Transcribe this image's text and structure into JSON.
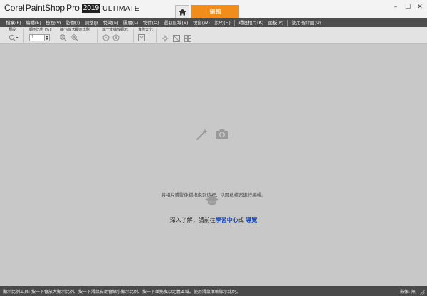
{
  "app": {
    "logo_corel": "Corel",
    "logo_paintshop": "PaintShop",
    "logo_pro": "Pro",
    "logo_year": "2019",
    "logo_edition": "ULTIMATE"
  },
  "tabs": {
    "edit": "編輯"
  },
  "window_controls": {
    "minimize": "–",
    "maximize": "☐",
    "close": "✕"
  },
  "menu": [
    "檔案(F)",
    "編輯(E)",
    "檢視(V)",
    "影像(I)",
    "調整(J)",
    "特效(E)",
    "圖層(L)",
    "物件(O)",
    "選取區域(S)",
    "視窗(W)",
    "說明(H)",
    "環繞相片(R)",
    "面板(P)",
    "使用者介面(U)"
  ],
  "toolbar": {
    "preset_label": "預設:",
    "zoom_percent_label": "顯示比例 (%):",
    "zoom_value": "1",
    "zoom_inout_label": "縮小/放大顯示比例:",
    "step_label": "進一步縮放顯示:",
    "actual_size_label": "實際大小:"
  },
  "workspace": {
    "drop_hint": "將相片或影像檔拖曳到這裡，以開啟檔案進行編輯。",
    "learn_prefix": "深入了解，請前往",
    "learning_center": "學習中心",
    "learn_or": "或",
    "guide": "導覽"
  },
  "status": {
    "text": "顯示比例工具: 按一下會放大顯示比例。按一下滑鼠右鍵會縮小顯示比例。按一下並拖曳以定義區域。使用滑鼠滾輪顯示比例。",
    "image": "影像: 無"
  },
  "colors": {
    "accent_orange": "#f28c1b",
    "menubar_bg": "#4d4d4d",
    "workspace_bg": "#c8c8c8",
    "statusbar_bg": "#4a4a4a",
    "link_blue": "#1546b8"
  },
  "icons": {
    "home": "home-icon",
    "wand": "magic-wand-icon",
    "camera": "camera-icon",
    "grad_cap": "graduation-cap-icon"
  }
}
